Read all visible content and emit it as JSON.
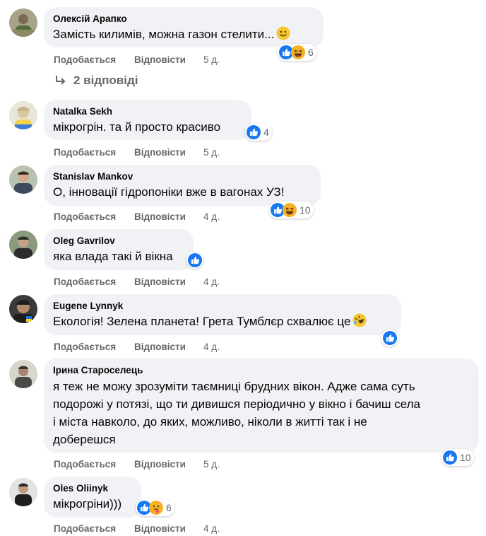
{
  "colors": {
    "like_blue": "#1877f2",
    "haha_yellow": "#f7b125",
    "bubble_bg": "#f0f2f5",
    "meta_grey": "#65676b"
  },
  "actions": {
    "like_label": "Подобається",
    "reply_label": "Відповісти"
  },
  "replies_link": {
    "label": "2 відповіді",
    "icon": "reply-arrow-icon"
  },
  "comments": [
    {
      "author": "Олексій Арапко",
      "text": "Замість килимів, можна газон стелити...",
      "inline_emoji": "slightly-smiling-face-icon",
      "reactions": [
        "like",
        "haha"
      ],
      "count": "6",
      "time": "5 д."
    },
    {
      "author": "Natalka Sekh",
      "text": "мікрогрін. та й просто красиво",
      "reactions": [
        "like"
      ],
      "count": "4",
      "time": "5 д."
    },
    {
      "author": "Stanislav Mankov",
      "text": "О, інновації гідропоніки вже в вагонах УЗ!",
      "reactions": [
        "like",
        "haha"
      ],
      "count": "10",
      "time": "4 д."
    },
    {
      "author": "Oleg Gavrilov",
      "text": "яка влада такі й вікна",
      "reactions": [
        "like"
      ],
      "count": "",
      "time": "4 д."
    },
    {
      "author": "Eugene Lynnyk",
      "text": "Екологія! Зелена планета! Грета Тумблєр схвалює це",
      "inline_emoji": "rolling-laughing-face-icon",
      "reactions": [
        "like"
      ],
      "count": "",
      "time": "4 д."
    },
    {
      "author": "Ірина Староселець",
      "lines": [
        "я теж не можу зрозуміти таємниці брудних вікон. Адже сама суть",
        "подорожі у потязі, що ти дивишся періодично у вікно і бачиш села",
        "і міста навколо, до яких, можливо, ніколи в житті так і не",
        "доберешся"
      ],
      "reactions": [
        "like"
      ],
      "count": "10",
      "time": "5 д."
    },
    {
      "author": "Oles Oliinyk",
      "text": "мікрогріни)))",
      "reactions": [
        "like",
        "care"
      ],
      "count": "6",
      "time": "4 д."
    }
  ]
}
